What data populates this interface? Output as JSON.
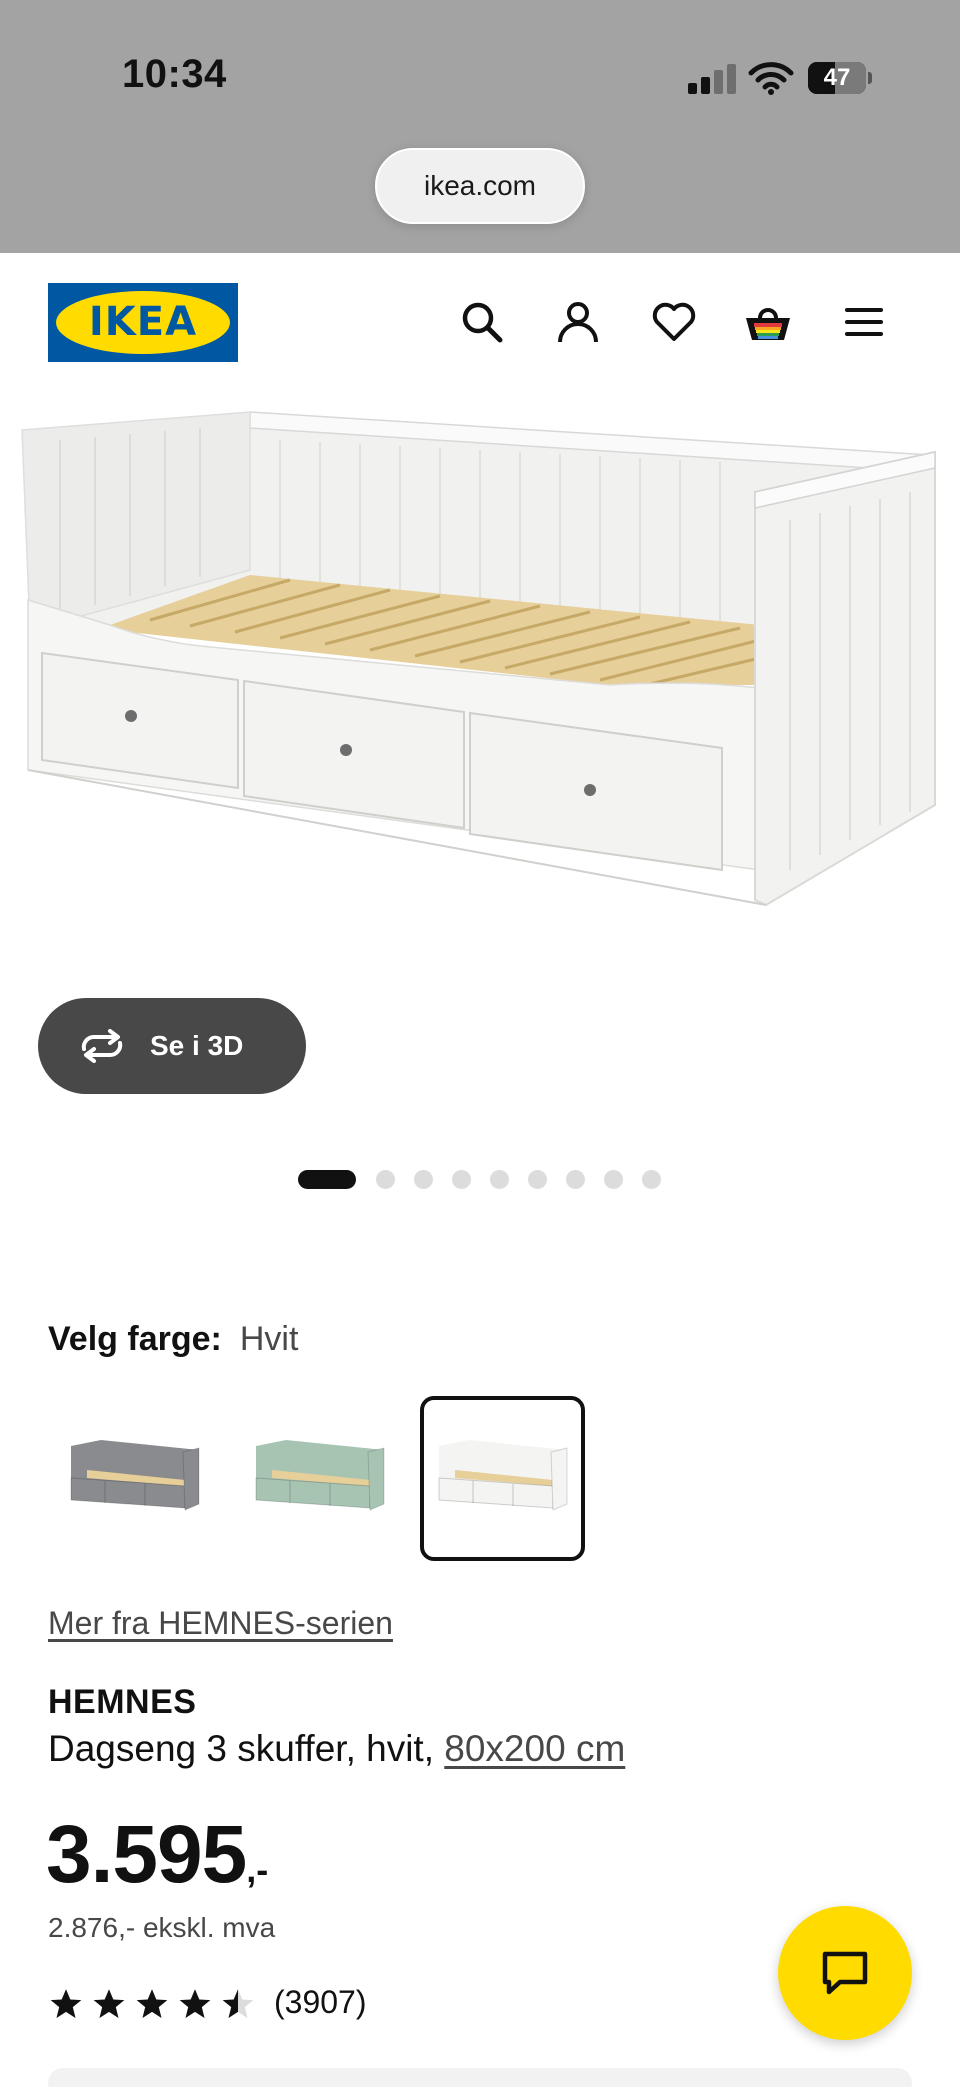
{
  "status_bar": {
    "time": "10:34",
    "battery": "47"
  },
  "browser": {
    "url": "ikea.com"
  },
  "header": {
    "logo_text": "IKEA",
    "logo_colors": {
      "blue": "#0058a3",
      "yellow": "#ffdb00"
    },
    "icons": [
      "search-icon",
      "account-icon",
      "wishlist-heart-icon",
      "shopping-bag-icon",
      "menu-icon"
    ]
  },
  "gallery": {
    "view_3d_label": "Se i 3D",
    "total_images": 9,
    "active_index": 0
  },
  "color_picker": {
    "label": "Velg farge:",
    "selected": "Hvit",
    "swatches": [
      {
        "color": "#8a8b8f",
        "selected": false
      },
      {
        "color": "#a7c4b3",
        "selected": false
      },
      {
        "color": "#f4f4f2",
        "selected": true
      }
    ]
  },
  "product": {
    "series_link": "Mer fra HEMNES-serien",
    "name": "HEMNES",
    "description": "Dagseng 3 skuffer, hvit,",
    "size_link": "80x200 cm",
    "price": "3.595",
    "price_suffix": ",-",
    "price_ex_vat": "2.876,- ekskl. mva",
    "rating": 4.5,
    "rating_max": 5,
    "review_count": "(3907)"
  },
  "chat": {
    "icon": "chat-icon",
    "accent": "#ffdb00"
  }
}
